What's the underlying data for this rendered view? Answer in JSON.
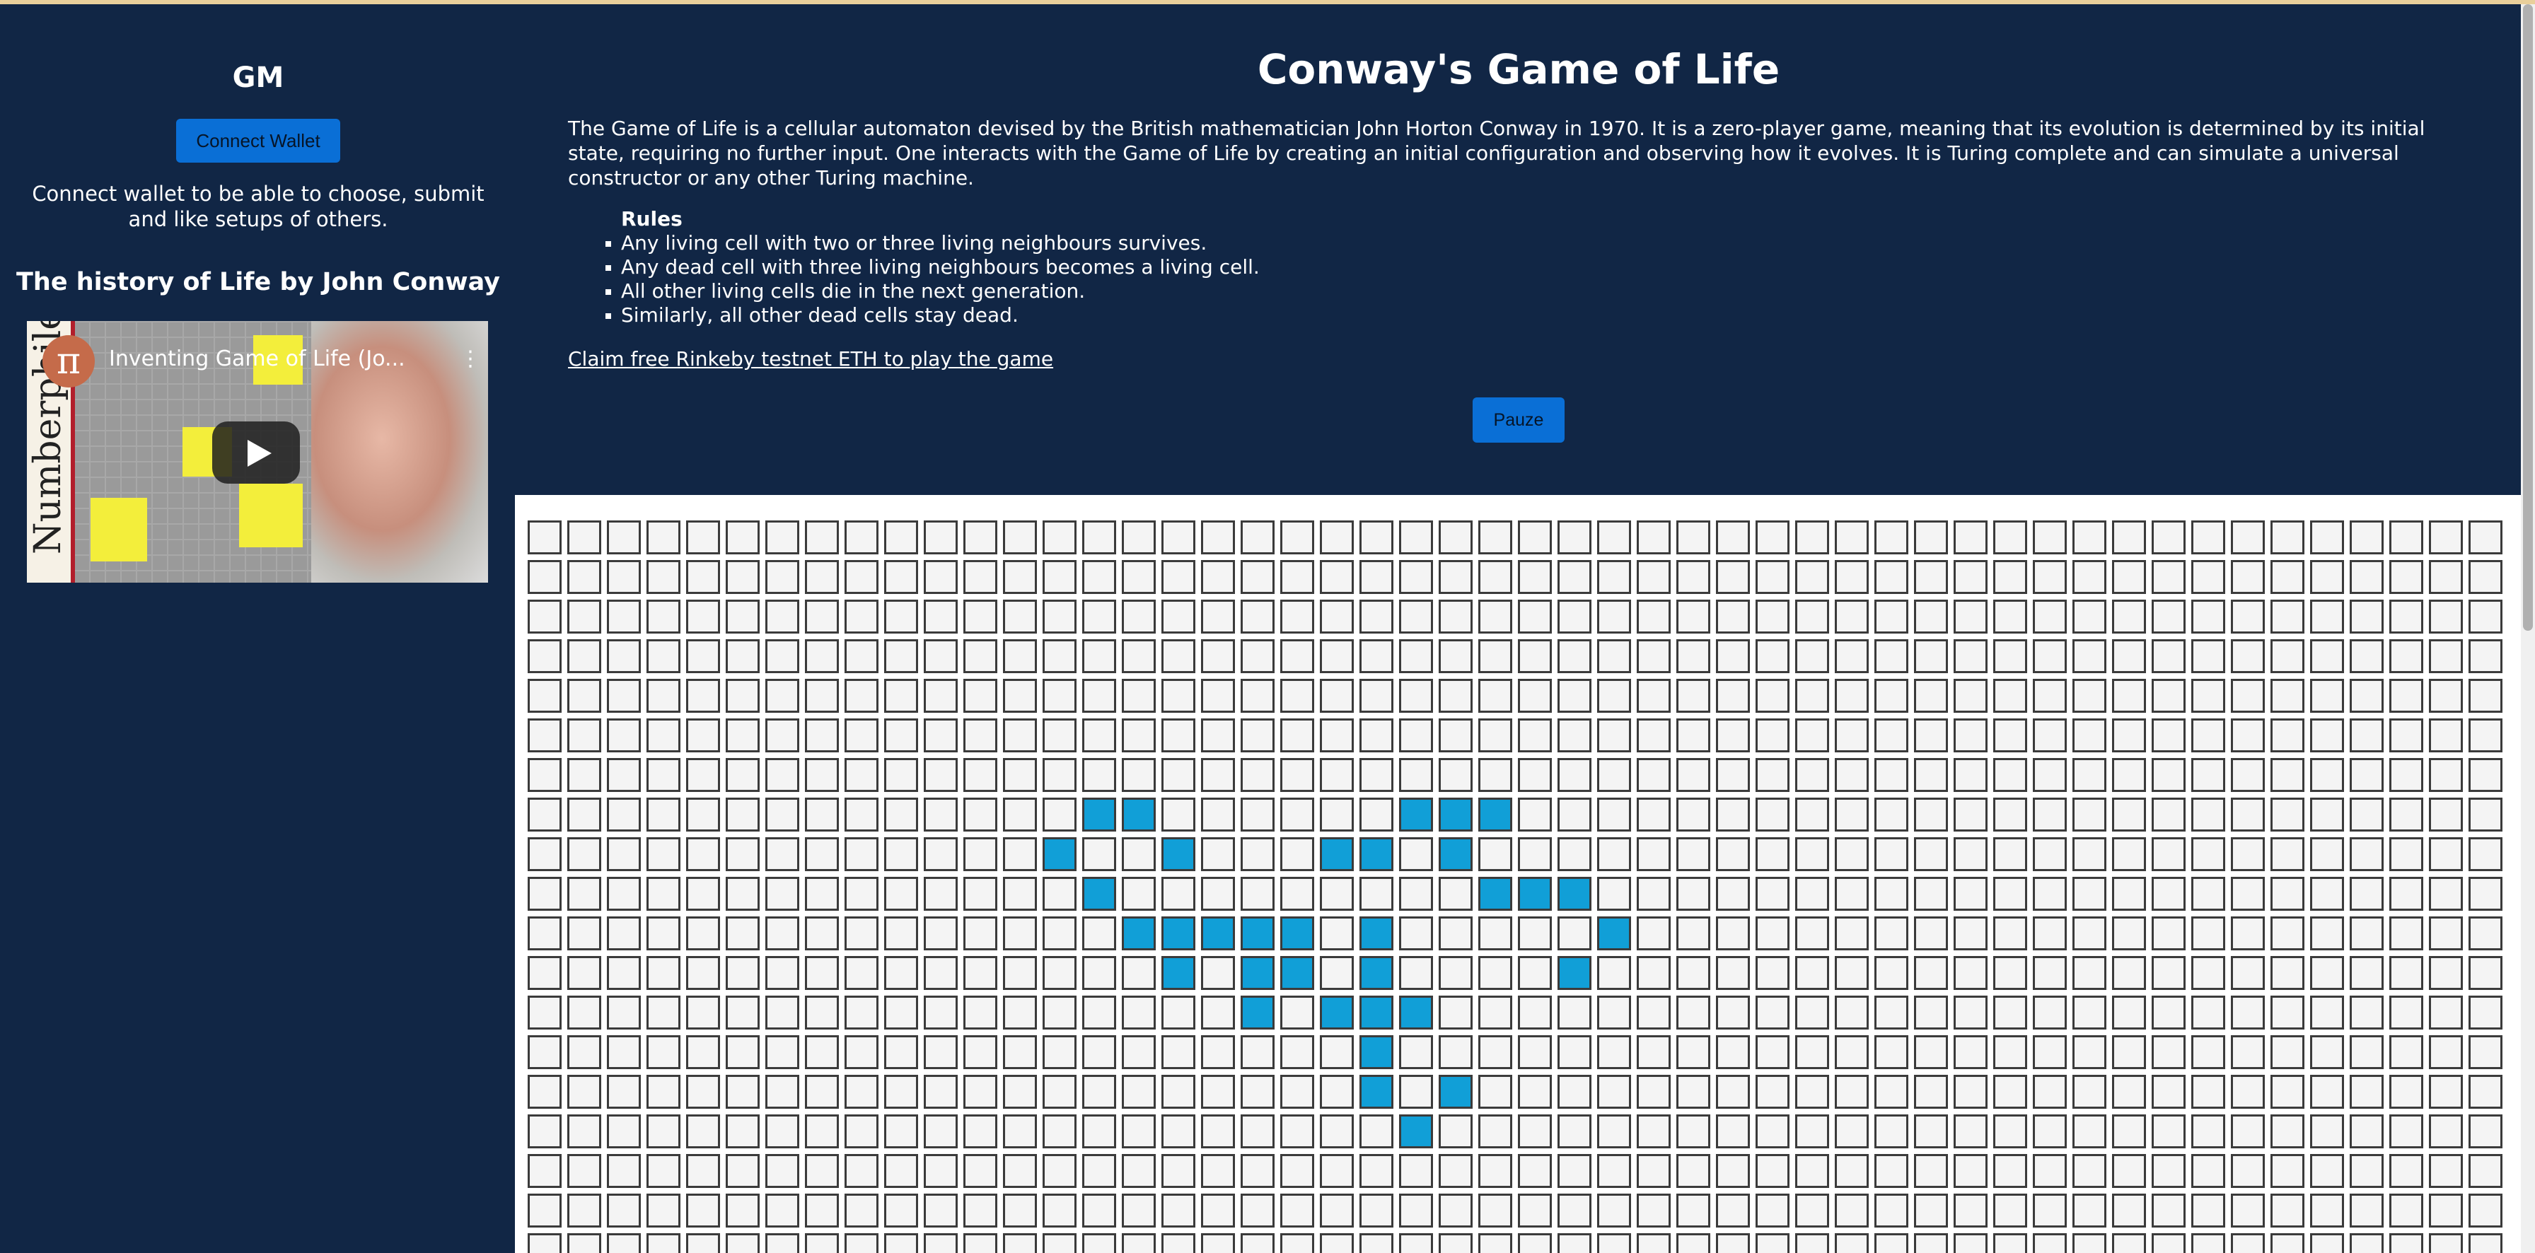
{
  "sidebar": {
    "brand": "GM",
    "connect_label": "Connect Wallet",
    "connect_note": "Connect wallet to be able to choose, submit and like setups of others.",
    "history_title": "The history of Life by John Conway",
    "video": {
      "title": "Inventing Game of Life (Jo...",
      "channel_text": "Numberphile",
      "play_icon": "play-icon",
      "more_icon": "kebab-menu-icon"
    }
  },
  "main": {
    "title": "Conway's Game of Life",
    "intro": "The Game of Life is a cellular automaton devised by the British mathematician John Horton Conway in 1970. It is a zero-player game, meaning that its evolution is determined by its initial state, requiring no further input. One interacts with the Game of Life by creating an initial configuration and observing how it evolves. It is Turing complete and can simulate a universal constructor or any other Turing machine.",
    "rules_title": "Rules",
    "rules": [
      "Any living cell with two or three living neighbours survives.",
      "Any dead cell with three living neighbours becomes a living cell.",
      "All other living cells die in the next generation.",
      "Similarly, all other dead cells stay dead."
    ],
    "claim_link": "Claim free Rinkeby testnet ETH to play the game",
    "pause_label": "Pauze"
  },
  "board": {
    "columns": 50,
    "visible_rows": 19,
    "colors": {
      "alive": "#119fd7",
      "dead": "#f4f4f4",
      "border": "#3b3b3b"
    },
    "alive_cells": [
      [
        7,
        14
      ],
      [
        7,
        15
      ],
      [
        7,
        22
      ],
      [
        7,
        23
      ],
      [
        7,
        24
      ],
      [
        8,
        13
      ],
      [
        8,
        16
      ],
      [
        8,
        20
      ],
      [
        8,
        21
      ],
      [
        8,
        23
      ],
      [
        9,
        14
      ],
      [
        9,
        24
      ],
      [
        9,
        25
      ],
      [
        9,
        26
      ],
      [
        10,
        15
      ],
      [
        10,
        16
      ],
      [
        10,
        17
      ],
      [
        10,
        18
      ],
      [
        10,
        19
      ],
      [
        10,
        21
      ],
      [
        10,
        27
      ],
      [
        11,
        16
      ],
      [
        11,
        18
      ],
      [
        11,
        19
      ],
      [
        11,
        21
      ],
      [
        11,
        26
      ],
      [
        12,
        18
      ],
      [
        12,
        20
      ],
      [
        12,
        21
      ],
      [
        12,
        22
      ],
      [
        13,
        21
      ],
      [
        14,
        21
      ],
      [
        14,
        23
      ],
      [
        15,
        22
      ]
    ]
  },
  "theme": {
    "background": "#112645",
    "accent": "#0a6fd6",
    "top_line": "#e9cf9b"
  }
}
